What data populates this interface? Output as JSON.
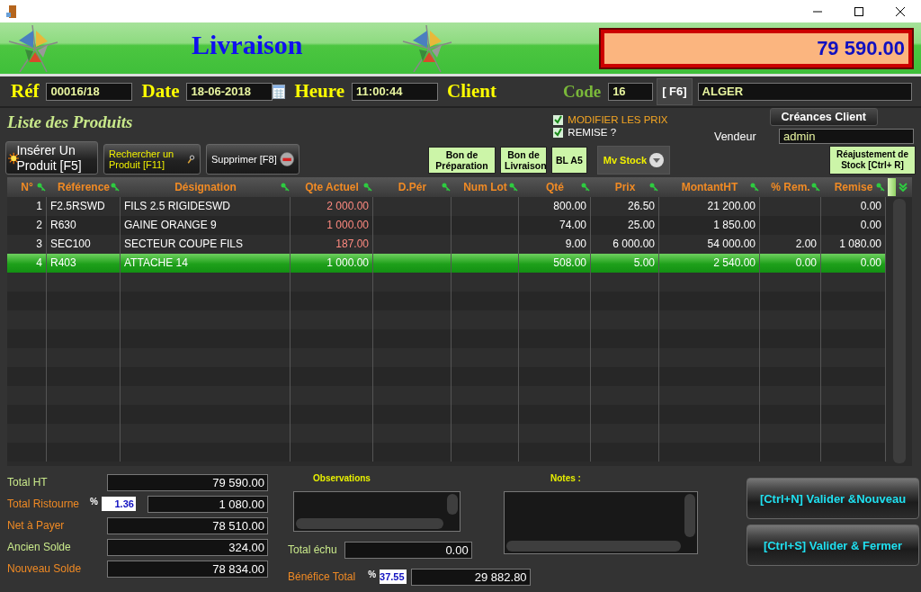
{
  "header": {
    "title": "Livraison",
    "total": "79 590.00"
  },
  "info_bar": {
    "fields": [
      {
        "label": "Réf",
        "value": "00016/18",
        "kind": "text"
      },
      {
        "label": "Date",
        "value": "18-06-2018",
        "kind": "date"
      },
      {
        "label": "Heure",
        "value": "11:00:44",
        "kind": "text"
      }
    ],
    "client_label": "Client",
    "code_label": "Code",
    "code": "16",
    "lookup_button": "[ F6]",
    "client_name": "ALGER"
  },
  "products": {
    "title": "Liste des Produits",
    "action_buttons": [
      {
        "label": "Insérer Un Produit [F5]",
        "kind": "insert"
      },
      {
        "label": "Rechercher un Produit  [F11]",
        "kind": "search"
      },
      {
        "label": "Supprimer [F8]",
        "kind": "delete"
      }
    ],
    "options": [
      {
        "label": "MODIFIER LES PRIX",
        "checked": true,
        "color": "#f5a623"
      },
      {
        "label": "REMISE ?",
        "checked": true,
        "color": "#ffffff"
      }
    ],
    "creances_button": "Créances Client",
    "vendeur_label": "Vendeur",
    "vendeur": "admin",
    "print_buttons": [
      "Bon de Préparation",
      "Bon de Livraison",
      "BL A5"
    ],
    "stock_menu": "Mv Stock",
    "adjust_button": "Réajustement de Stock  [Ctrl+ R]"
  },
  "table": {
    "columns": [
      "N°",
      "Référence",
      "Désignation",
      "Qte Actuel",
      "D.Pér",
      "Num Lot",
      "Qté",
      "Prix",
      "MontantHT",
      "% Rem.",
      "Remise"
    ],
    "rows": [
      {
        "selected": false,
        "cells": [
          "1",
          "F2.5RSWD",
          "FILS 2.5 RIGIDESWD",
          "2 000.00",
          null,
          null,
          "800.00",
          "26.50",
          "21 200.00",
          null,
          "0.00"
        ]
      },
      {
        "selected": false,
        "cells": [
          "2",
          "R630",
          "GAINE ORANGE 9",
          "1 000.00",
          null,
          null,
          "74.00",
          "25.00",
          "1 850.00",
          null,
          "0.00"
        ]
      },
      {
        "selected": false,
        "cells": [
          "3",
          "SEC100",
          "SECTEUR COUPE FILS",
          "187.00",
          null,
          null,
          "9.00",
          "6 000.00",
          "54 000.00",
          "2.00",
          "1 080.00"
        ]
      },
      {
        "selected": true,
        "cells": [
          "4",
          "R403",
          "ATTACHE 14",
          "1 000.00",
          null,
          null,
          "508.00",
          "5.00",
          "2 540.00",
          "0.00",
          "0.00"
        ]
      }
    ]
  },
  "totals": [
    {
      "label": "Total HT",
      "value": "79 590.00",
      "color": "#c8e88a"
    },
    {
      "label": "Total Ristourne",
      "percent": "1.36",
      "value": "1 080.00",
      "color": "#f08a24"
    },
    {
      "label": "Net à Payer",
      "value": "78 510.00",
      "color": "#f08a24"
    },
    {
      "label": "Ancien Solde",
      "value": "324.00",
      "color": "#c8e88a"
    },
    {
      "label": "Nouveau Solde",
      "value": "78 834.00",
      "color": "#f08a24"
    }
  ],
  "observations_label": "Observations",
  "notes_label": "Notes :",
  "total_echu": {
    "label": "Total échu",
    "value": "0.00"
  },
  "benefice": {
    "label": "Bénéfice Total",
    "percent": "37.55",
    "value": "29 882.80"
  },
  "percent_sign": "%",
  "buttons": [
    "[Ctrl+N] Valider &Nouveau",
    "[Ctrl+S] Valider & Fermer"
  ]
}
